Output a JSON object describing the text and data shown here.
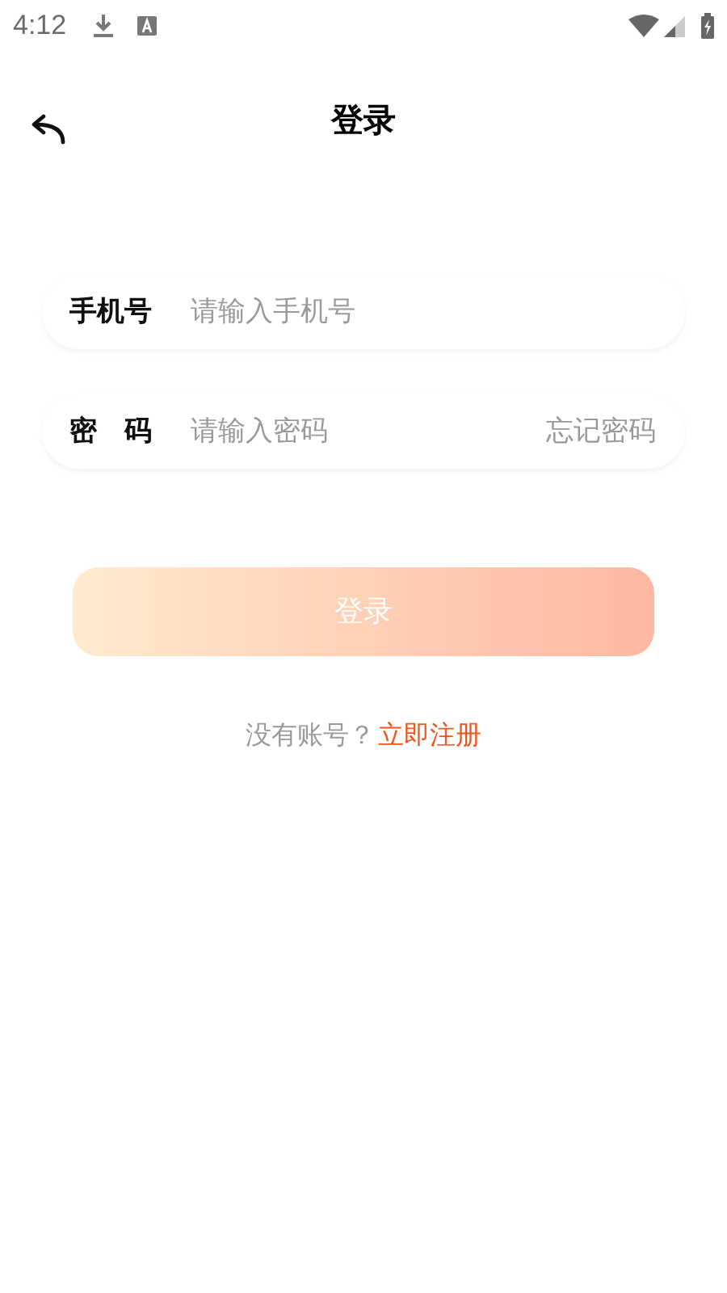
{
  "status_bar": {
    "time": "4:12"
  },
  "header": {
    "title": "登录"
  },
  "fields": [
    {
      "label": "手机号",
      "placeholder": "请输入手机号"
    },
    {
      "label": "密　码",
      "placeholder": "请输入密码",
      "action": "忘记密码"
    }
  ],
  "login_button": {
    "label": "登录",
    "disabled": true
  },
  "register": {
    "prompt": "没有账号？",
    "link": "立即注册"
  }
}
